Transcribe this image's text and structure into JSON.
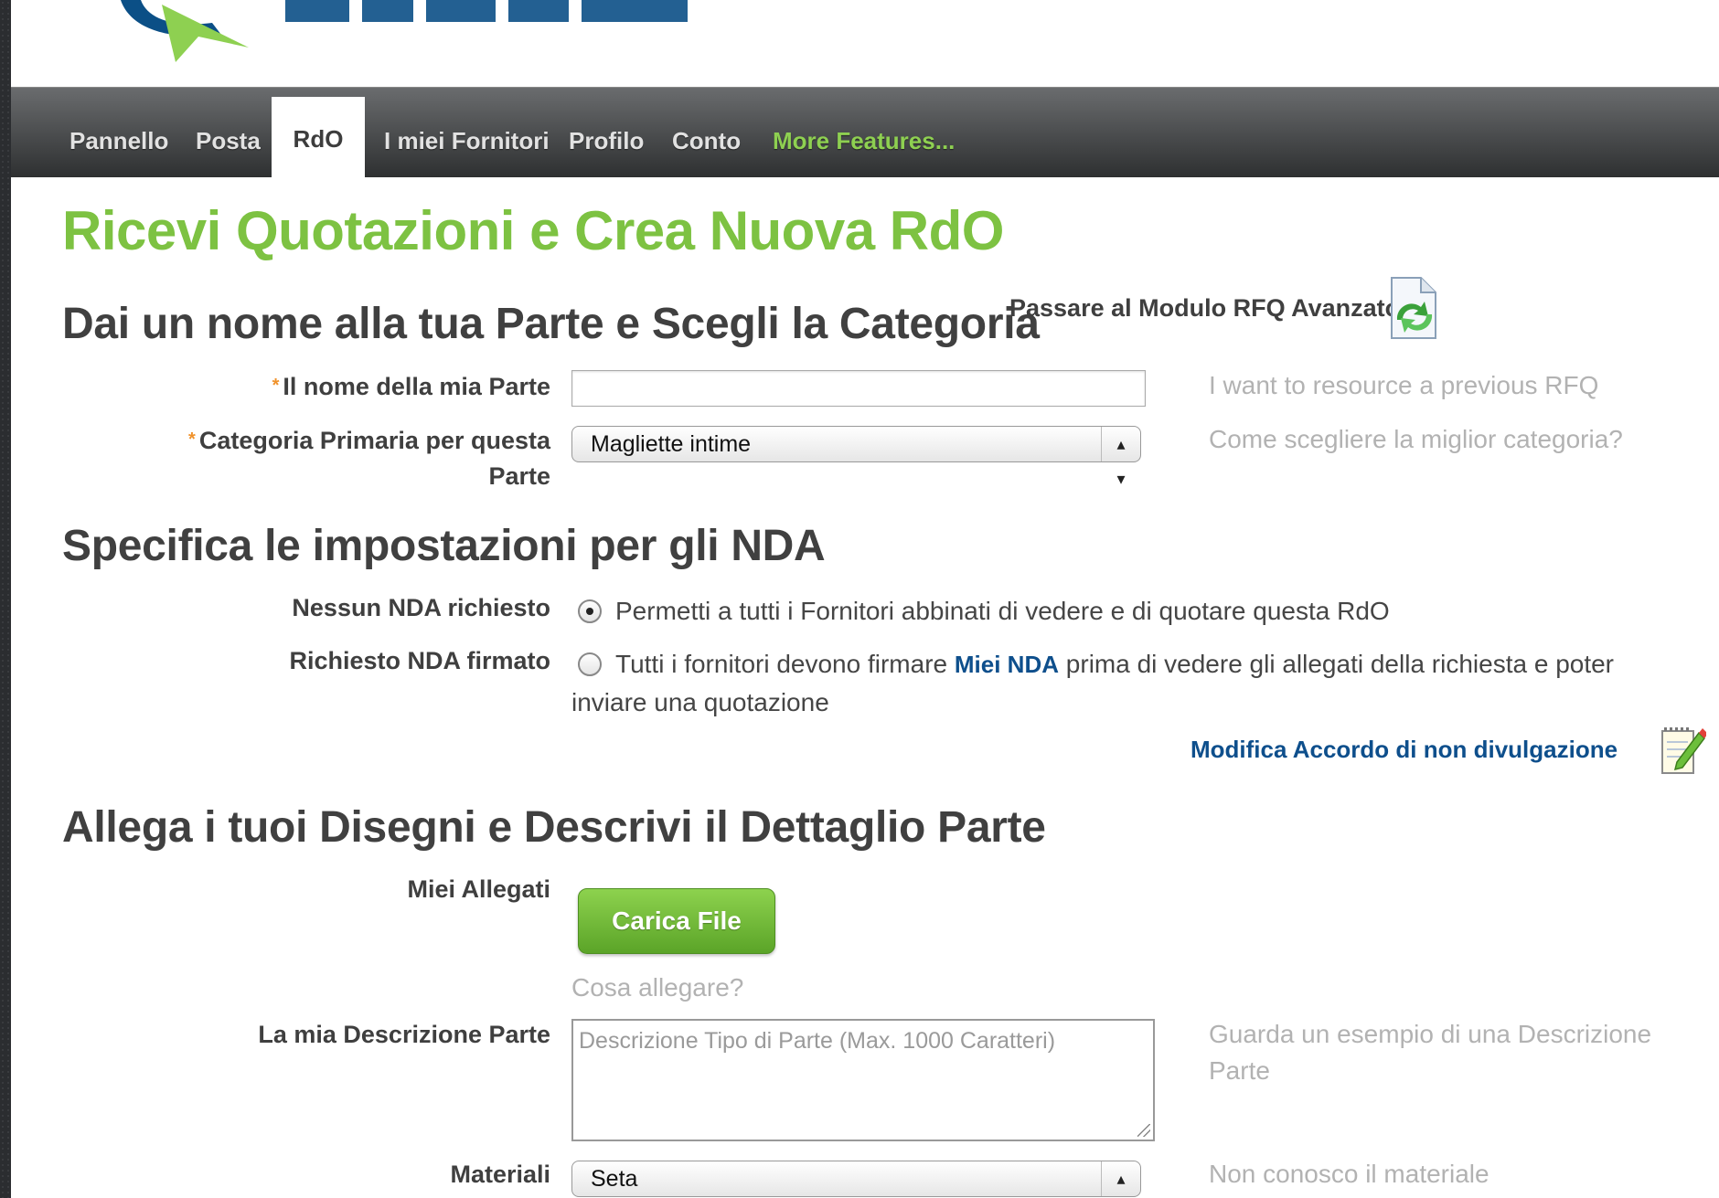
{
  "nav": {
    "items": [
      {
        "label": "Pannello",
        "active": false
      },
      {
        "label": "Posta",
        "active": false
      },
      {
        "label": "RdO",
        "active": true
      },
      {
        "label": "I miei Fornitori",
        "active": false
      },
      {
        "label": "Profilo",
        "active": false
      },
      {
        "label": "Conto",
        "active": false
      },
      {
        "label": "More Features...",
        "active": false
      }
    ]
  },
  "page": {
    "title": "Ricevi Quotazioni e Crea Nuova RdO",
    "advanced_link": "Passare al Modulo RFQ Avanzato"
  },
  "section1": {
    "heading": "Dai un nome alla tua Parte e Scegli la Categoria",
    "part_name_label": "Il nome della mia Parte",
    "part_name_value": "",
    "category_label_line1": "Categoria Primaria per questa",
    "category_label_line2": "Parte",
    "category_value": "Magliette intime",
    "hint_previous_rfq": "I want to resource a previous RFQ",
    "hint_category": "Come scegliere la miglior categoria?"
  },
  "section2": {
    "heading": "Specifica le impostazioni per gli NDA",
    "option1_label": "Nessun NDA richiesto",
    "option1_text": "Permetti a tutti i Fornitori abbinati di vedere e di quotare questa RdO",
    "option1_selected": true,
    "option2_label": "Richiesto NDA firmato",
    "option2_text_before": "Tutti i fornitori devono firmare",
    "option2_link": "Miei NDA",
    "option2_text_after": "prima di vedere gli allegati della richiesta e poter",
    "option2_text_line2": "inviare una quotazione",
    "option2_selected": false,
    "edit_nda_link": "Modifica Accordo di non divulgazione"
  },
  "section3": {
    "heading": "Allega i tuoi Disegni e Descrivi il Dettaglio Parte",
    "attachments_label": "Miei Allegati",
    "upload_button": "Carica File",
    "what_to_attach": "Cosa allegare?",
    "description_label": "La mia Descrizione Parte",
    "description_placeholder": "Descrizione Tipo di Parte (Max. 1000 Caratteri)",
    "hint_example_line1": "Guarda un esempio di una Descrizione",
    "hint_example_line2": "Parte",
    "materials_label": "Materiali",
    "materials_value": "Seta",
    "hint_material": "Non conosco il materiale"
  },
  "colors": {
    "brand_green": "#7dc242",
    "link_blue": "#0e4f8c",
    "required_orange": "#f0922b"
  },
  "icons": {
    "advanced_form": "refresh-document-icon",
    "edit_nda": "notepad-pencil-icon"
  }
}
